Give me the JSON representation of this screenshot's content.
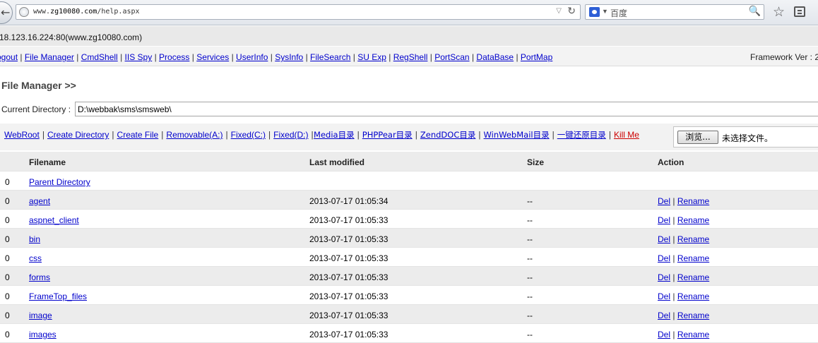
{
  "browser": {
    "url_prefix": "www.",
    "url_host": "zg10080.com",
    "url_path": "/help.aspx",
    "search_placeholder": "百度"
  },
  "server_info": "18.123.16.224:80(www.zg10080.com)",
  "nav": {
    "links": [
      "ogout",
      "File Manager",
      "CmdShell",
      "IIS Spy",
      "Process",
      "Services",
      "UserInfo",
      "SysInfo",
      "FileSearch",
      "SU Exp",
      "RegShell",
      "PortScan",
      "DataBase",
      "PortMap"
    ],
    "framework": "Framework Ver : 2"
  },
  "file_manager": {
    "title": "File Manager >>",
    "current_dir_label": "Current Directory :",
    "current_dir": "D:\\webbak\\sms\\smsweb\\"
  },
  "tools": {
    "links": [
      "WebRoot",
      "Create Directory",
      "Create File",
      "Removable(A:)",
      "Fixed(C:)",
      "Fixed(D:)",
      "Media目录",
      "PHPPear目录",
      "ZendDOC目录",
      "WinWebMail目录",
      "一键还原目录"
    ],
    "kill": "Kill Me",
    "browse_button": "浏览...",
    "no_file": "未选择文件。"
  },
  "table": {
    "headers": [
      "",
      "Filename",
      "Last modified",
      "Size",
      "Action"
    ],
    "parent": {
      "num": "0",
      "name": "Parent Directory"
    },
    "rows": [
      {
        "num": "0",
        "name": "agent",
        "modified": "2013-07-17 01:05:34",
        "size": "--"
      },
      {
        "num": "0",
        "name": "aspnet_client",
        "modified": "2013-07-17 01:05:33",
        "size": "--"
      },
      {
        "num": "0",
        "name": "bin",
        "modified": "2013-07-17 01:05:33",
        "size": "--"
      },
      {
        "num": "0",
        "name": "css",
        "modified": "2013-07-17 01:05:33",
        "size": "--"
      },
      {
        "num": "0",
        "name": "forms",
        "modified": "2013-07-17 01:05:33",
        "size": "--"
      },
      {
        "num": "0",
        "name": "FrameTop_files",
        "modified": "2013-07-17 01:05:33",
        "size": "--"
      },
      {
        "num": "0",
        "name": "image",
        "modified": "2013-07-17 01:05:33",
        "size": "--"
      },
      {
        "num": "0",
        "name": "images",
        "modified": "2013-07-17 01:05:33",
        "size": "--"
      }
    ],
    "action_del": "Del",
    "action_rename": "Rename"
  }
}
